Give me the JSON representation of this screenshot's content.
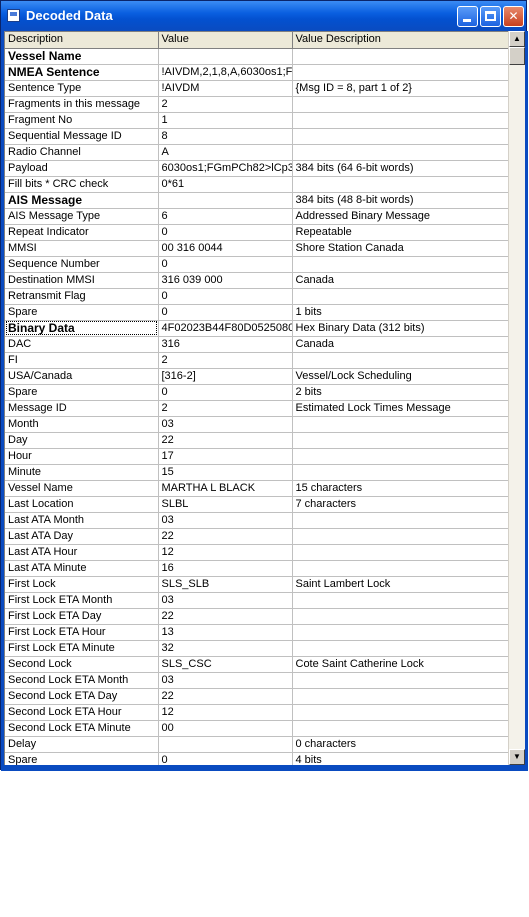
{
  "window": {
    "title": "Decoded Data",
    "minimize_glyph": "_",
    "maximize_glyph": "□",
    "close_glyph": "✕"
  },
  "table": {
    "headers": [
      "Description",
      "Value",
      "Value Description"
    ],
    "rows": [
      {
        "description": "Vessel Name",
        "value": "",
        "value_description": "",
        "bold": true
      },
      {
        "description": "NMEA Sentence",
        "value": "!AIVDM,2,1,8,A,6030os1;F",
        "value_description": "",
        "bold": true
      },
      {
        "description": "Sentence Type",
        "value": "!AIVDM",
        "value_description": "{Msg ID = 8, part 1 of 2}"
      },
      {
        "description": "Fragments in this message",
        "value": "2",
        "value_description": ""
      },
      {
        "description": "Fragment No",
        "value": "1",
        "value_description": ""
      },
      {
        "description": "Sequential Message ID",
        "value": "8",
        "value_description": ""
      },
      {
        "description": "Radio Channel",
        "value": "A",
        "value_description": ""
      },
      {
        "description": "Payload",
        "value": "6030os1;FGmPCh82>lCp3",
        "value_description": "384 bits (64 6-bit words)"
      },
      {
        "description": "Fill bits * CRC check",
        "value": "0*61",
        "value_description": ""
      },
      {
        "description": "AIS Message",
        "value": "",
        "value_description": "384 bits (48 8-bit words)",
        "bold": true
      },
      {
        "description": "AIS Message Type",
        "value": "6",
        "value_description": "Addressed Binary Message"
      },
      {
        "description": "Repeat Indicator",
        "value": "0",
        "value_description": "Repeatable"
      },
      {
        "description": "MMSI",
        "value": "00 316 0044",
        "value_description": "Shore Station Canada"
      },
      {
        "description": "Sequence Number",
        "value": "0",
        "value_description": ""
      },
      {
        "description": "Destination MMSI",
        "value": "316 039 000",
        "value_description": "Canada"
      },
      {
        "description": "Retransmit Flag",
        "value": "0",
        "value_description": ""
      },
      {
        "description": "Spare",
        "value": "0",
        "value_description": "1 bits"
      },
      {
        "description": "Binary Data",
        "value": "4F02023B44F80D0525080",
        "value_description": "Hex Binary Data (312 bits)",
        "bold": true,
        "selected": true
      },
      {
        "description": "DAC",
        "value": "316",
        "value_description": "Canada"
      },
      {
        "description": "FI",
        "value": "2",
        "value_description": ""
      },
      {
        "description": "USA/Canada",
        "value": "[316-2]",
        "value_description": "Vessel/Lock Scheduling"
      },
      {
        "description": "Spare",
        "value": "0",
        "value_description": "2 bits"
      },
      {
        "description": "Message ID",
        "value": "2",
        "value_description": "Estimated Lock Times Message"
      },
      {
        "description": "Month",
        "value": "03",
        "value_description": ""
      },
      {
        "description": "Day",
        "value": "22",
        "value_description": ""
      },
      {
        "description": "Hour",
        "value": "17",
        "value_description": ""
      },
      {
        "description": "Minute",
        "value": "15",
        "value_description": ""
      },
      {
        "description": "Vessel Name",
        "value": " MARTHA L BLACK",
        "value_description": "15 characters"
      },
      {
        "description": "Last Location",
        "value": "  SLBL",
        "value_description": "7 characters"
      },
      {
        "description": "Last ATA Month",
        "value": "03",
        "value_description": ""
      },
      {
        "description": "Last ATA Day",
        "value": "22",
        "value_description": ""
      },
      {
        "description": "Last ATA Hour",
        "value": "12",
        "value_description": ""
      },
      {
        "description": "Last ATA Minute",
        "value": "16",
        "value_description": ""
      },
      {
        "description": "First Lock",
        "value": "SLS_SLB",
        "value_description": "Saint Lambert Lock"
      },
      {
        "description": "First Lock ETA Month",
        "value": "03",
        "value_description": ""
      },
      {
        "description": "First Lock ETA Day",
        "value": "22",
        "value_description": ""
      },
      {
        "description": "First Lock ETA Hour",
        "value": "13",
        "value_description": ""
      },
      {
        "description": "First Lock ETA Minute",
        "value": "32",
        "value_description": ""
      },
      {
        "description": "Second Lock",
        "value": "SLS_CSC",
        "value_description": "Cote Saint Catherine Lock"
      },
      {
        "description": "Second Lock ETA Month",
        "value": "03",
        "value_description": ""
      },
      {
        "description": "Second Lock ETA Day",
        "value": "22",
        "value_description": ""
      },
      {
        "description": "Second Lock ETA Hour",
        "value": "12",
        "value_description": ""
      },
      {
        "description": "Second Lock ETA Minute",
        "value": "00",
        "value_description": ""
      },
      {
        "description": "Delay",
        "value": "",
        "value_description": "0 characters"
      },
      {
        "description": "Spare",
        "value": "0",
        "value_description": "4 bits"
      }
    ]
  },
  "scrollbar": {
    "up_glyph": "▲",
    "down_glyph": "▼"
  }
}
